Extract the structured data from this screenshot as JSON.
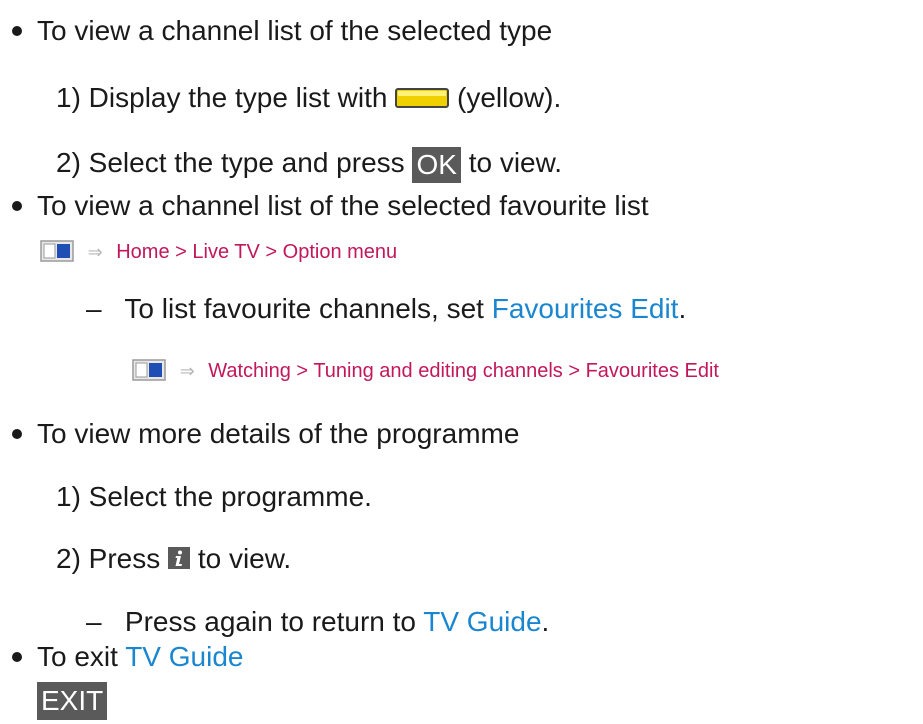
{
  "bullets": [
    {
      "text": "To view a channel list of the selected type"
    },
    {
      "text": "To view a channel list of the selected favourite list"
    },
    {
      "text": "To view more details of the programme"
    },
    {
      "text_prefix": "To exit ",
      "link": "TV Guide"
    }
  ],
  "type_steps": {
    "step1_prefix": "1) Display the type list with",
    "step1_suffix": "(yellow).",
    "step2_prefix": "2) Select the type and press",
    "step2_key": "OK",
    "step2_suffix": "to view."
  },
  "fav_path": {
    "crumbs": [
      "Home",
      "Live TV",
      "Option menu"
    ],
    "separator": ">"
  },
  "fav_note": {
    "prefix": "To list favourite channels, set",
    "link": "Favourites Edit",
    "suffix": "."
  },
  "fav_note_path": {
    "crumbs": [
      "Watching",
      "Tuning and editing channels",
      "Favourites Edit"
    ],
    "separator": ">"
  },
  "details_steps": {
    "step1": "1) Select the programme.",
    "step2_prefix": "2) Press",
    "step2_suffix": "to view.",
    "note_prefix": "Press again to return to",
    "note_link": "TV Guide",
    "note_suffix": "."
  },
  "exit_key": "EXIT",
  "dash": "–",
  "arrow_glyph": "⇒",
  "icons": {
    "menu": "tv-menu-icon",
    "yellow": "yellow-button-icon",
    "info": "info-button-icon",
    "arrow": "arrow-right-icon"
  },
  "colors": {
    "text": "#1a1a1a",
    "link": "#1a86d0",
    "path": "#c2185b",
    "key_bg": "#5a5a5a",
    "yellow": "#f0d000"
  }
}
